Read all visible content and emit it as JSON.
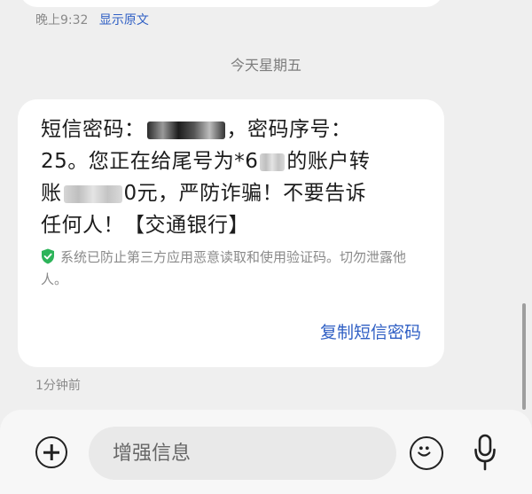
{
  "header": {
    "time": "晚上9:32",
    "show_original": "显示原文"
  },
  "date_separator": "今天星期五",
  "message": {
    "line1_a": "短信密码：",
    "line1_b": "，密码序号：",
    "line2_a": "25。您正在给尾号为*6",
    "line2_b": "的账户转",
    "line3_a": "账",
    "line3_b": "0元，严防诈骗！不要告诉",
    "line4": "任何人！【交通银行】",
    "security_notice": "系统已防止第三方应用恶意读取和使用验证码。切勿泄露他人。",
    "copy_button": "复制短信密码"
  },
  "timestamp": "1分钟前",
  "compose": {
    "placeholder": "增强信息"
  },
  "icons": {
    "shield": "shield-check-icon",
    "add": "plus-circle-icon",
    "emoji": "smiley-icon",
    "mic": "microphone-icon"
  },
  "colors": {
    "accent": "#2f5fc4",
    "shield": "#2db45a",
    "background": "#efefef"
  }
}
